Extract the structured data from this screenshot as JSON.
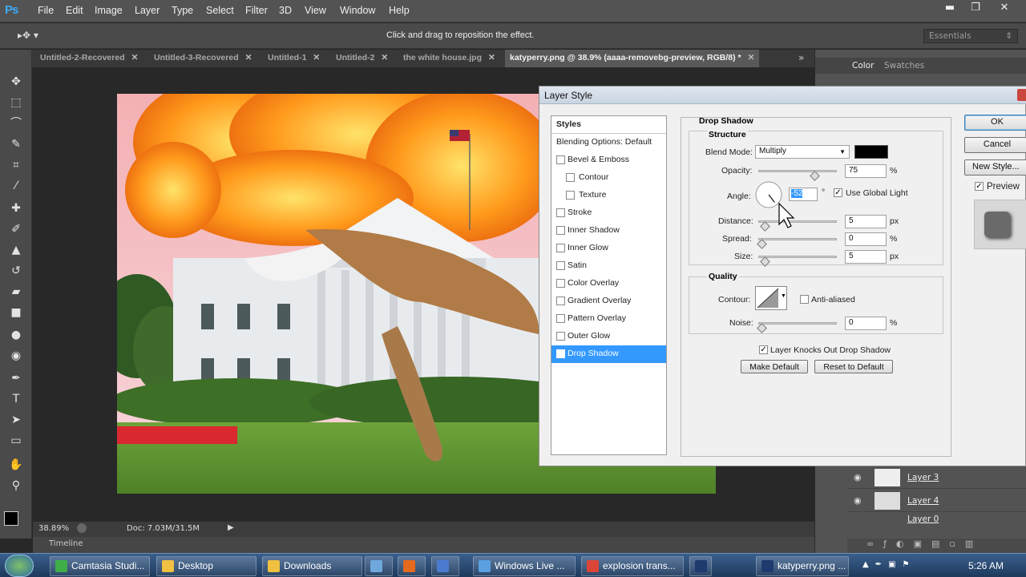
{
  "app": {
    "logo": "Ps",
    "menus": [
      "File",
      "Edit",
      "Image",
      "Layer",
      "Type",
      "Select",
      "Filter",
      "3D",
      "View",
      "Window",
      "Help"
    ],
    "window_controls": [
      "minimize-icon",
      "restore-icon",
      "close-icon"
    ]
  },
  "options_bar": {
    "hint": "Click and drag to reposition the effect.",
    "workspace": "Essentials"
  },
  "tabs": [
    {
      "label": "Untitled-2-Recovered"
    },
    {
      "label": "Untitled-3-Recovered"
    },
    {
      "label": "Untitled-1"
    },
    {
      "label": "Untitled-2"
    },
    {
      "label": "the white house.jpg"
    },
    {
      "label": "katyperry.png @ 38.9% (aaaa-removebg-preview, RGB/8) *",
      "active": true
    }
  ],
  "status": {
    "zoom": "38.89%",
    "doc": "Doc: 7.03M/31.5M",
    "timeline": "Timeline"
  },
  "right_panel": {
    "tabs": [
      "Color",
      "Swatches"
    ],
    "layers": [
      "Layer 3",
      "Layer 4",
      "Layer 0"
    ]
  },
  "dialog": {
    "title": "Layer Style",
    "styles_header": "Styles",
    "style_items": [
      {
        "label": "Blending Options: Default",
        "checkbox": false,
        "checked": false,
        "sub": false,
        "selected": false
      },
      {
        "label": "Bevel & Emboss",
        "checkbox": true,
        "checked": false,
        "sub": false,
        "selected": false
      },
      {
        "label": "Contour",
        "checkbox": true,
        "checked": false,
        "sub": true,
        "selected": false
      },
      {
        "label": "Texture",
        "checkbox": true,
        "checked": false,
        "sub": true,
        "selected": false
      },
      {
        "label": "Stroke",
        "checkbox": true,
        "checked": false,
        "sub": false,
        "selected": false
      },
      {
        "label": "Inner Shadow",
        "checkbox": true,
        "checked": false,
        "sub": false,
        "selected": false
      },
      {
        "label": "Inner Glow",
        "checkbox": true,
        "checked": false,
        "sub": false,
        "selected": false
      },
      {
        "label": "Satin",
        "checkbox": true,
        "checked": false,
        "sub": false,
        "selected": false
      },
      {
        "label": "Color Overlay",
        "checkbox": true,
        "checked": false,
        "sub": false,
        "selected": false
      },
      {
        "label": "Gradient Overlay",
        "checkbox": true,
        "checked": false,
        "sub": false,
        "selected": false
      },
      {
        "label": "Pattern Overlay",
        "checkbox": true,
        "checked": false,
        "sub": false,
        "selected": false
      },
      {
        "label": "Outer Glow",
        "checkbox": true,
        "checked": false,
        "sub": false,
        "selected": false
      },
      {
        "label": "Drop Shadow",
        "checkbox": true,
        "checked": true,
        "sub": false,
        "selected": true
      }
    ],
    "section_title": "Drop Shadow",
    "structure": {
      "title": "Structure",
      "blend_mode_label": "Blend Mode:",
      "blend_mode": "Multiply",
      "shadow_color": "#000000",
      "opacity_label": "Opacity:",
      "opacity": "75",
      "opacity_unit": "%",
      "opacity_level": 0.75,
      "angle_label": "Angle:",
      "angle": "-52",
      "angle_unit": "°",
      "global_light_label": "Use Global Light",
      "global_light": true,
      "distance_label": "Distance:",
      "distance": "5",
      "distance_unit": "px",
      "distance_level": 0.05,
      "spread_label": "Spread:",
      "spread": "0",
      "spread_unit": "%",
      "spread_level": 0.0,
      "size_label": "Size:",
      "size": "5",
      "size_unit": "px",
      "size_level": 0.05
    },
    "quality": {
      "title": "Quality",
      "contour_label": "Contour:",
      "anti_aliased_label": "Anti-aliased",
      "noise_label": "Noise:",
      "noise": "0",
      "noise_unit": "%",
      "noise_level": 0.0
    },
    "knockout_label": "Layer Knocks Out Drop Shadow",
    "make_default": "Make Default",
    "reset_default": "Reset to Default",
    "ok": "OK",
    "cancel": "Cancel",
    "new_style": "New Style...",
    "preview_label": "Preview"
  },
  "taskbar": {
    "items": [
      {
        "label": "Camtasia Studi...",
        "color": "#3fae49"
      },
      {
        "label": "Desktop",
        "color": "#f0c040"
      },
      {
        "label": "Downloads",
        "color": "#f0c040"
      },
      {
        "label": "",
        "color": "#6fa8dc"
      },
      {
        "label": "",
        "color": "#e66a1e"
      },
      {
        "label": "",
        "color": "#4a7bd0"
      },
      {
        "label": "Windows Live ...",
        "color": "#5aa0e0"
      },
      {
        "label": "explosion trans...",
        "color": "#db4437"
      },
      {
        "label": "",
        "color": "#1e3a6e"
      },
      {
        "label": "katyperry.png ...",
        "color": "#1e3a6e"
      }
    ],
    "clock": "5:26 AM"
  }
}
